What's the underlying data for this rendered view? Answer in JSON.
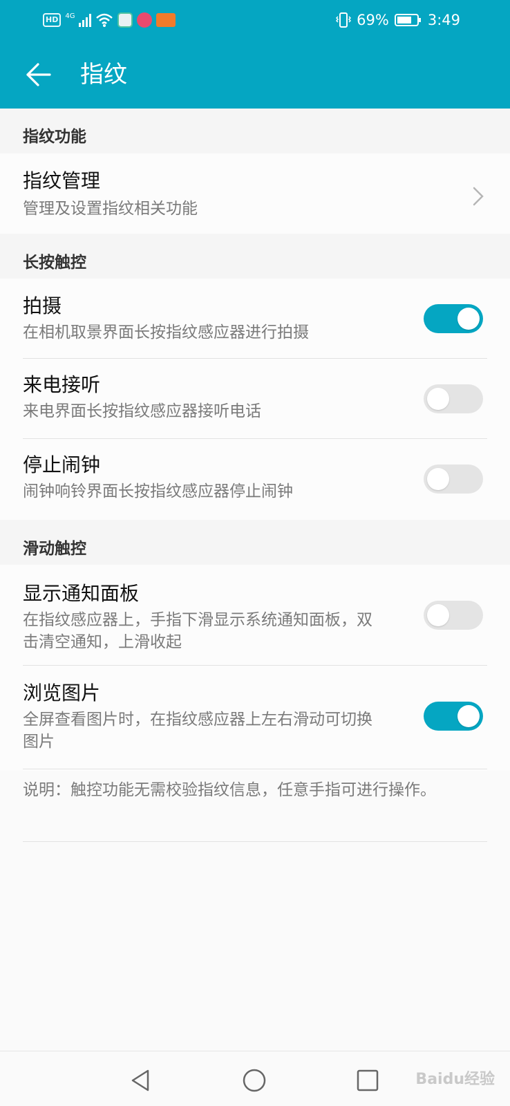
{
  "status_bar": {
    "left_badges": {
      "hd": "HD",
      "network": "4G"
    },
    "battery_percent": "69%",
    "time": "3:49"
  },
  "toolbar": {
    "title": "指纹"
  },
  "sections": {
    "fingerprint_function": {
      "title": "指纹功能",
      "items": [
        {
          "title": "指纹管理",
          "subtitle": "管理及设置指纹相关功能"
        }
      ]
    },
    "long_press": {
      "title": "长按触控",
      "items": [
        {
          "title": "拍摄",
          "subtitle": "在相机取景界面长按指纹感应器进行拍摄",
          "enabled": true
        },
        {
          "title": "来电接听",
          "subtitle": "来电界面长按指纹感应器接听电话",
          "enabled": false
        },
        {
          "title": "停止闹钟",
          "subtitle": "闹钟响铃界面长按指纹感应器停止闹钟",
          "enabled": false
        }
      ]
    },
    "swipe": {
      "title": "滑动触控",
      "items": [
        {
          "title": "显示通知面板",
          "subtitle": "在指纹感应器上，手指下滑显示系统通知面板，双击清空通知，上滑收起",
          "enabled": false
        },
        {
          "title": "浏览图片",
          "subtitle": "全屏查看图片时，在指纹感应器上左右滑动可切换图片",
          "enabled": true
        }
      ]
    }
  },
  "note": "说明：触控功能无需校验指纹信息，任意手指可进行操作。",
  "watermark": "Baidu经验",
  "colors": {
    "accent": "#05a6c2",
    "switch_off": "#e4e4e4"
  }
}
